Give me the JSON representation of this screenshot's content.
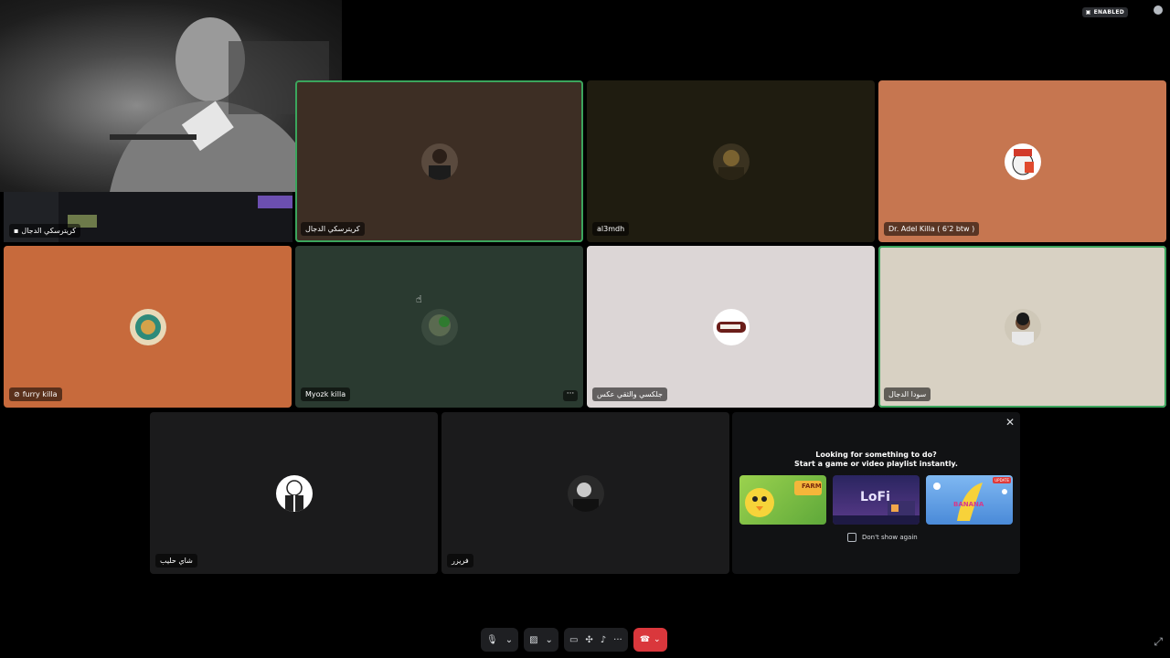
{
  "top_right": {
    "enabled_badge": "ENABLED"
  },
  "stream": {
    "owner_label": "كريترسكي الدجال"
  },
  "tiles": [
    {
      "name": "كريترسكي الدجال",
      "bg": "#3d2e24",
      "speaking": true
    },
    {
      "name": "al3mdh",
      "bg": "#1f1c10",
      "speaking": false
    },
    {
      "name": "Dr. Adel Killa ( 6'2 btw )",
      "bg": "#c67650",
      "speaking": false
    },
    {
      "name": "furry killa",
      "bg": "#c76a3c",
      "speaking": false,
      "icon": "stream-off-icon"
    },
    {
      "name": "Myozk killa",
      "bg": "#2a3a30",
      "speaking": false,
      "more": "···"
    },
    {
      "name": "جلكسي والثقي عكس",
      "bg": "#dcd6d6",
      "speaking": false
    },
    {
      "name": "سودا الدجال",
      "bg": "#d8d1c3",
      "speaking": true
    },
    {
      "name": "شاي حليب",
      "bg": "#1b1b1c",
      "speaking": false
    },
    {
      "name": "فريزر",
      "bg": "#1b1b1c",
      "speaking": false
    }
  ],
  "promo": {
    "title_line1": "Looking for something to do?",
    "title_line2": "Start a game or video playlist instantly.",
    "dont_show": "Don't show again",
    "close": "✕",
    "cards": [
      {
        "name": "Farm",
        "label": "FARM",
        "bg": "#8cc24a"
      },
      {
        "name": "LoFi",
        "label": "LoFi",
        "bg": "#3a2c78"
      },
      {
        "name": "Banana Boom",
        "label": "BANANA",
        "bg": "#6ba6e8",
        "badge": "UPDATE"
      }
    ]
  },
  "controls": {
    "more": "···",
    "caret": "⌄"
  }
}
